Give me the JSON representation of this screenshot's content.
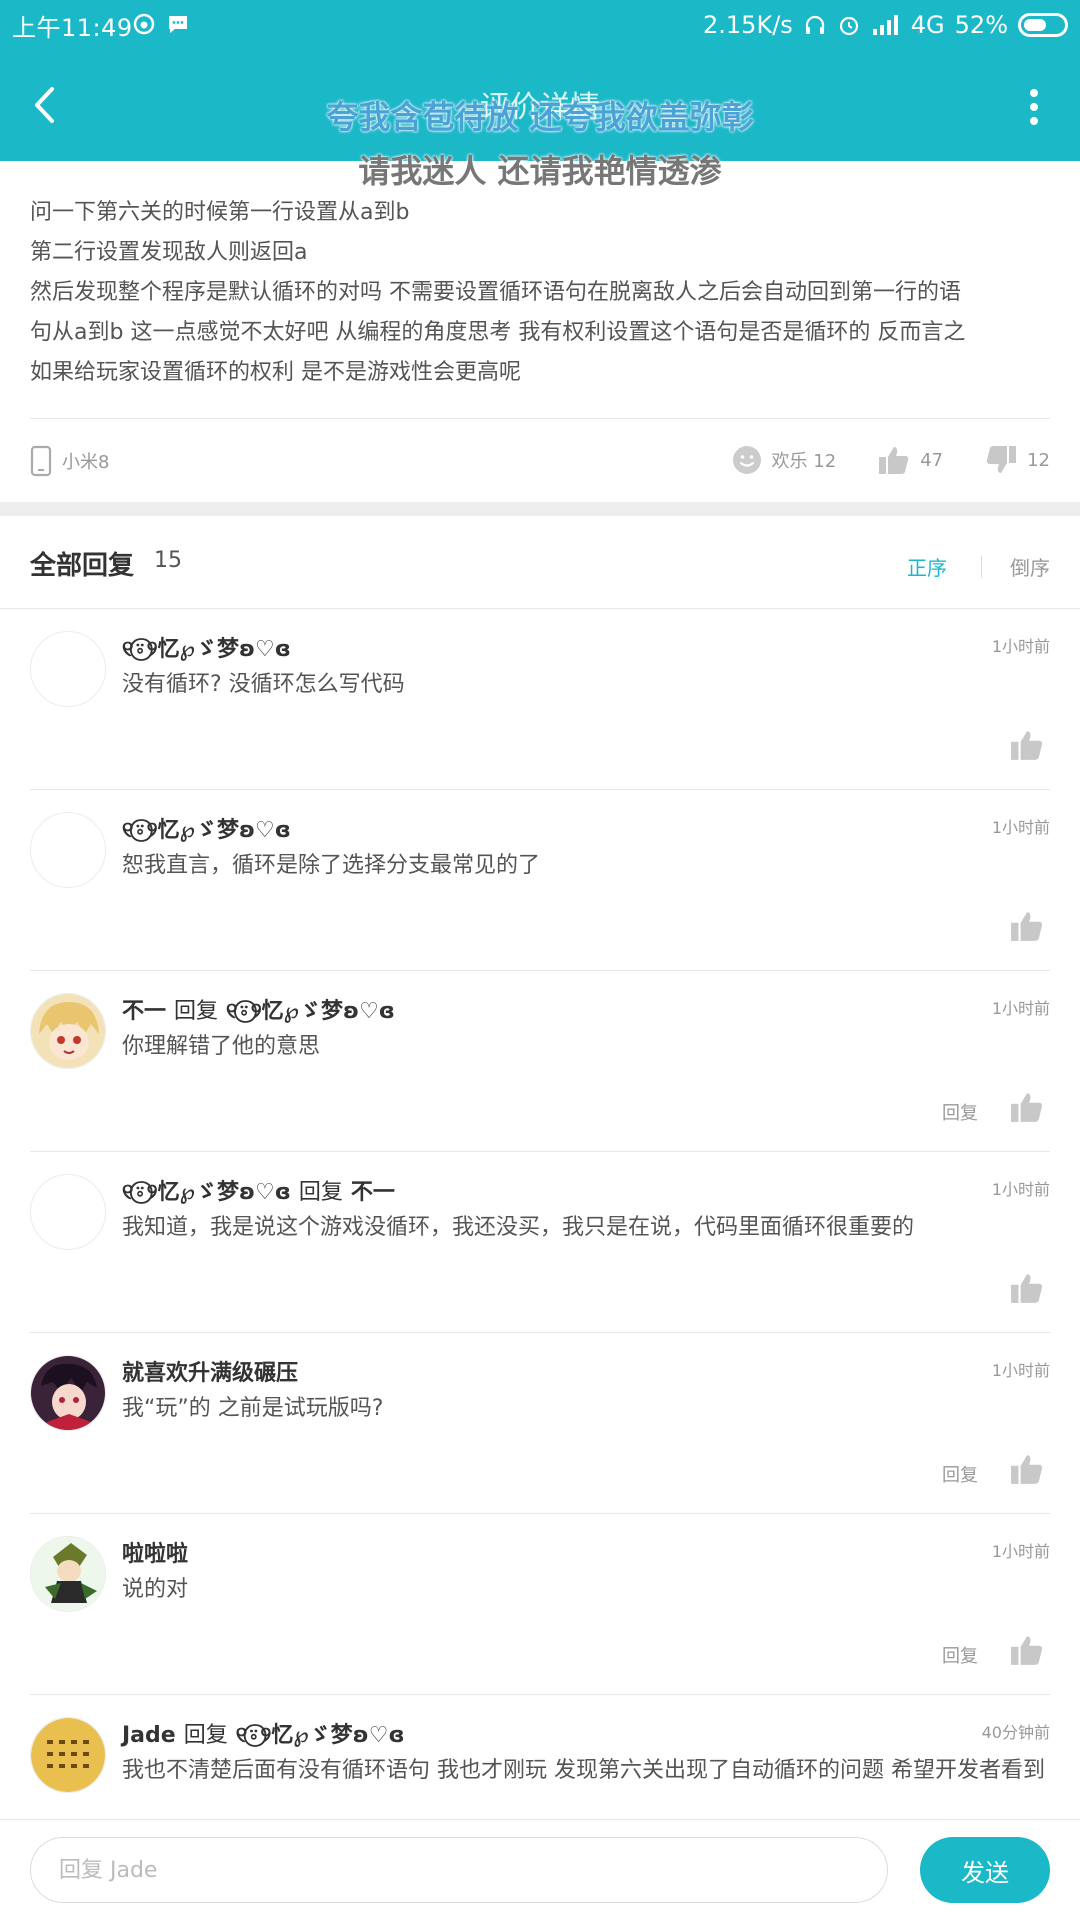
{
  "status_bar": {
    "time": "上午11:49",
    "net_speed": "2.15K/s",
    "network": "4G",
    "battery": "52%"
  },
  "nav": {
    "title": "评价详情",
    "overlay_line1": "夸我含苞待放 还夸我欲盖弥彰",
    "overlay_line2": "请我迷人 还请我艳情透渗"
  },
  "question": {
    "lines": [
      "问一下第六关的时候第一行设置从a到b",
      "第二行设置发现敌人则返回a",
      "然后发现整个程序是默认循环的对吗 不需要设置循环语句在脱离敌人之后会自动回到第一行的语",
      "句从a到b 这一点感觉不太好吧 从编程的角度思考 我有权利设置这个语句是否是循环的 反而言之",
      "如果给玩家设置循环的权利 是不是游戏性会更高呢"
    ],
    "device": "小米8",
    "reactions": {
      "fun_label": "欢乐 12",
      "likes": "47",
      "dislikes": "12"
    }
  },
  "replies_section": {
    "title": "全部回复",
    "count": "15",
    "sort_asc": "正序",
    "sort_desc": "倒序"
  },
  "replies": [
    {
      "name": "୧⍤⃝୨忆℘ゞ梦ʚ♡ɞ",
      "reply_word": "",
      "target": "",
      "time": "1小时前",
      "text": "没有循环? 没循环怎么写代码",
      "reply_btn": ""
    },
    {
      "name": "୧⍤⃝୨忆℘ゞ梦ʚ♡ɞ",
      "reply_word": "",
      "target": "",
      "time": "1小时前",
      "text": "恕我直言，循环是除了选择分支最常见的了",
      "reply_btn": ""
    },
    {
      "name": "不一",
      "reply_word": "回复",
      "target": "୧⍤⃝୨忆℘ゞ梦ʚ♡ɞ",
      "time": "1小时前",
      "text": "你理解错了他的意思",
      "reply_btn": "回复"
    },
    {
      "name": "୧⍤⃝୨忆℘ゞ梦ʚ♡ɞ",
      "reply_word": "回复",
      "target": "不一",
      "time": "1小时前",
      "text": "我知道，我是说这个游戏没循环，我还没买，我只是在说，代码里面循环很重要的",
      "reply_btn": ""
    },
    {
      "name": "就喜欢升满级碾压",
      "reply_word": "",
      "target": "",
      "time": "1小时前",
      "text": "我“玩”的  之前是试玩版吗?",
      "reply_btn": "回复"
    },
    {
      "name": "啦啦啦",
      "reply_word": "",
      "target": "",
      "time": "1小时前",
      "text": "说的对",
      "reply_btn": "回复"
    },
    {
      "name": "Jade",
      "reply_word": "回复",
      "target": "୧⍤⃝୨忆℘ゞ梦ʚ♡ɞ",
      "time": "40分钟前",
      "text": "我也不清楚后面有没有循环语句 我也才刚玩 发现第六关出现了自动循环的问题 希望开发者看到",
      "reply_btn": ""
    }
  ],
  "input": {
    "placeholder": "回复 Jade",
    "send_label": "发送"
  },
  "colors": {
    "accent": "#1bb8c8",
    "divider": "#e8e8e8"
  }
}
